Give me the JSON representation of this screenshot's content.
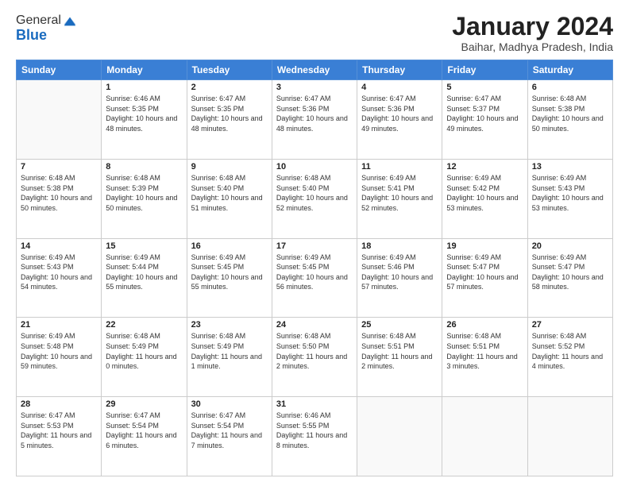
{
  "logo": {
    "general": "General",
    "blue": "Blue"
  },
  "header": {
    "month": "January 2024",
    "location": "Baihar, Madhya Pradesh, India"
  },
  "weekdays": [
    "Sunday",
    "Monday",
    "Tuesday",
    "Wednesday",
    "Thursday",
    "Friday",
    "Saturday"
  ],
  "weeks": [
    [
      {
        "day": "",
        "sunrise": "",
        "sunset": "",
        "daylight": ""
      },
      {
        "day": "1",
        "sunrise": "Sunrise: 6:46 AM",
        "sunset": "Sunset: 5:35 PM",
        "daylight": "Daylight: 10 hours and 48 minutes."
      },
      {
        "day": "2",
        "sunrise": "Sunrise: 6:47 AM",
        "sunset": "Sunset: 5:35 PM",
        "daylight": "Daylight: 10 hours and 48 minutes."
      },
      {
        "day": "3",
        "sunrise": "Sunrise: 6:47 AM",
        "sunset": "Sunset: 5:36 PM",
        "daylight": "Daylight: 10 hours and 48 minutes."
      },
      {
        "day": "4",
        "sunrise": "Sunrise: 6:47 AM",
        "sunset": "Sunset: 5:36 PM",
        "daylight": "Daylight: 10 hours and 49 minutes."
      },
      {
        "day": "5",
        "sunrise": "Sunrise: 6:47 AM",
        "sunset": "Sunset: 5:37 PM",
        "daylight": "Daylight: 10 hours and 49 minutes."
      },
      {
        "day": "6",
        "sunrise": "Sunrise: 6:48 AM",
        "sunset": "Sunset: 5:38 PM",
        "daylight": "Daylight: 10 hours and 50 minutes."
      }
    ],
    [
      {
        "day": "7",
        "sunrise": "Sunrise: 6:48 AM",
        "sunset": "Sunset: 5:38 PM",
        "daylight": "Daylight: 10 hours and 50 minutes."
      },
      {
        "day": "8",
        "sunrise": "Sunrise: 6:48 AM",
        "sunset": "Sunset: 5:39 PM",
        "daylight": "Daylight: 10 hours and 50 minutes."
      },
      {
        "day": "9",
        "sunrise": "Sunrise: 6:48 AM",
        "sunset": "Sunset: 5:40 PM",
        "daylight": "Daylight: 10 hours and 51 minutes."
      },
      {
        "day": "10",
        "sunrise": "Sunrise: 6:48 AM",
        "sunset": "Sunset: 5:40 PM",
        "daylight": "Daylight: 10 hours and 52 minutes."
      },
      {
        "day": "11",
        "sunrise": "Sunrise: 6:49 AM",
        "sunset": "Sunset: 5:41 PM",
        "daylight": "Daylight: 10 hours and 52 minutes."
      },
      {
        "day": "12",
        "sunrise": "Sunrise: 6:49 AM",
        "sunset": "Sunset: 5:42 PM",
        "daylight": "Daylight: 10 hours and 53 minutes."
      },
      {
        "day": "13",
        "sunrise": "Sunrise: 6:49 AM",
        "sunset": "Sunset: 5:43 PM",
        "daylight": "Daylight: 10 hours and 53 minutes."
      }
    ],
    [
      {
        "day": "14",
        "sunrise": "Sunrise: 6:49 AM",
        "sunset": "Sunset: 5:43 PM",
        "daylight": "Daylight: 10 hours and 54 minutes."
      },
      {
        "day": "15",
        "sunrise": "Sunrise: 6:49 AM",
        "sunset": "Sunset: 5:44 PM",
        "daylight": "Daylight: 10 hours and 55 minutes."
      },
      {
        "day": "16",
        "sunrise": "Sunrise: 6:49 AM",
        "sunset": "Sunset: 5:45 PM",
        "daylight": "Daylight: 10 hours and 55 minutes."
      },
      {
        "day": "17",
        "sunrise": "Sunrise: 6:49 AM",
        "sunset": "Sunset: 5:45 PM",
        "daylight": "Daylight: 10 hours and 56 minutes."
      },
      {
        "day": "18",
        "sunrise": "Sunrise: 6:49 AM",
        "sunset": "Sunset: 5:46 PM",
        "daylight": "Daylight: 10 hours and 57 minutes."
      },
      {
        "day": "19",
        "sunrise": "Sunrise: 6:49 AM",
        "sunset": "Sunset: 5:47 PM",
        "daylight": "Daylight: 10 hours and 57 minutes."
      },
      {
        "day": "20",
        "sunrise": "Sunrise: 6:49 AM",
        "sunset": "Sunset: 5:47 PM",
        "daylight": "Daylight: 10 hours and 58 minutes."
      }
    ],
    [
      {
        "day": "21",
        "sunrise": "Sunrise: 6:49 AM",
        "sunset": "Sunset: 5:48 PM",
        "daylight": "Daylight: 10 hours and 59 minutes."
      },
      {
        "day": "22",
        "sunrise": "Sunrise: 6:48 AM",
        "sunset": "Sunset: 5:49 PM",
        "daylight": "Daylight: 11 hours and 0 minutes."
      },
      {
        "day": "23",
        "sunrise": "Sunrise: 6:48 AM",
        "sunset": "Sunset: 5:49 PM",
        "daylight": "Daylight: 11 hours and 1 minute."
      },
      {
        "day": "24",
        "sunrise": "Sunrise: 6:48 AM",
        "sunset": "Sunset: 5:50 PM",
        "daylight": "Daylight: 11 hours and 2 minutes."
      },
      {
        "day": "25",
        "sunrise": "Sunrise: 6:48 AM",
        "sunset": "Sunset: 5:51 PM",
        "daylight": "Daylight: 11 hours and 2 minutes."
      },
      {
        "day": "26",
        "sunrise": "Sunrise: 6:48 AM",
        "sunset": "Sunset: 5:51 PM",
        "daylight": "Daylight: 11 hours and 3 minutes."
      },
      {
        "day": "27",
        "sunrise": "Sunrise: 6:48 AM",
        "sunset": "Sunset: 5:52 PM",
        "daylight": "Daylight: 11 hours and 4 minutes."
      }
    ],
    [
      {
        "day": "28",
        "sunrise": "Sunrise: 6:47 AM",
        "sunset": "Sunset: 5:53 PM",
        "daylight": "Daylight: 11 hours and 5 minutes."
      },
      {
        "day": "29",
        "sunrise": "Sunrise: 6:47 AM",
        "sunset": "Sunset: 5:54 PM",
        "daylight": "Daylight: 11 hours and 6 minutes."
      },
      {
        "day": "30",
        "sunrise": "Sunrise: 6:47 AM",
        "sunset": "Sunset: 5:54 PM",
        "daylight": "Daylight: 11 hours and 7 minutes."
      },
      {
        "day": "31",
        "sunrise": "Sunrise: 6:46 AM",
        "sunset": "Sunset: 5:55 PM",
        "daylight": "Daylight: 11 hours and 8 minutes."
      },
      {
        "day": "",
        "sunrise": "",
        "sunset": "",
        "daylight": ""
      },
      {
        "day": "",
        "sunrise": "",
        "sunset": "",
        "daylight": ""
      },
      {
        "day": "",
        "sunrise": "",
        "sunset": "",
        "daylight": ""
      }
    ]
  ]
}
